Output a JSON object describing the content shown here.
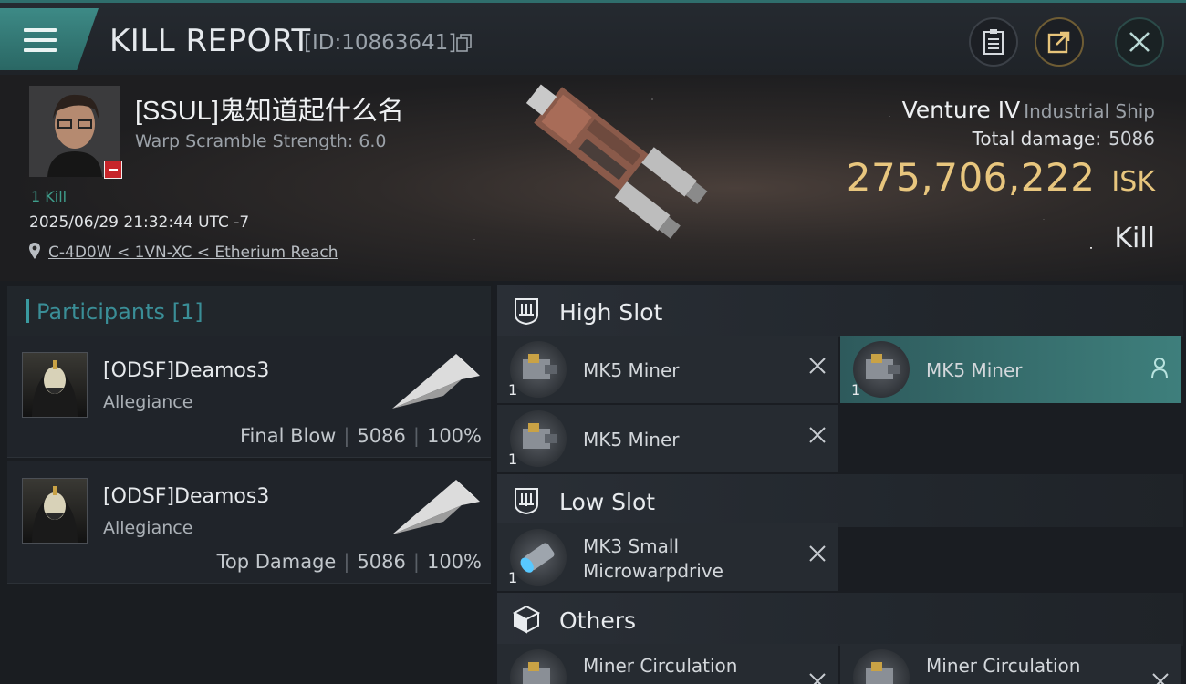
{
  "header": {
    "title": "KILL REPORT",
    "report_id": "[ID:10863641]"
  },
  "victim": {
    "name": "[SSUL]鬼知道起什么名",
    "warp_scramble": "Warp Scramble Strength: 6.0",
    "kill_count": "1 Kill",
    "timestamp": "2025/06/29 21:32:44 UTC -7",
    "location": "C-4D0W < 1VN-XC < Etherium Reach",
    "ship_name": "Venture IV",
    "ship_class": "Industrial Ship",
    "total_damage_label": "Total damage:",
    "total_damage": "5086",
    "isk_value": "275,706,222",
    "isk_unit": "ISK",
    "result": "Kill"
  },
  "participants": {
    "title": "Participants",
    "count": "[1]",
    "rows": [
      {
        "name": "[ODSF]Deamos3",
        "corp": "Allegiance",
        "role": "Final Blow",
        "damage": "5086",
        "percent": "100%"
      },
      {
        "name": "[ODSF]Deamos3",
        "corp": "Allegiance",
        "role": "Top Damage",
        "damage": "5086",
        "percent": "100%"
      }
    ]
  },
  "fitting": {
    "high_slot": {
      "label": "High Slot",
      "modules": [
        {
          "name": "MK5 Miner",
          "qty": "1"
        },
        {
          "name": "MK5 Miner",
          "qty": "1"
        },
        {
          "name": "MK5 Miner",
          "qty": "1"
        }
      ]
    },
    "low_slot": {
      "label": "Low Slot",
      "modules": [
        {
          "name_line1": "MK3 Small",
          "name_line2": "Microwarpdrive",
          "qty": "1"
        }
      ]
    },
    "others": {
      "label": "Others",
      "modules": [
        {
          "name": "Miner Circulation"
        },
        {
          "name": "Miner Circulation"
        }
      ]
    }
  },
  "colors": {
    "accent_teal": "#3a9aa0",
    "isk_gold": "#e8c67e",
    "badge_red": "#c7252a"
  }
}
